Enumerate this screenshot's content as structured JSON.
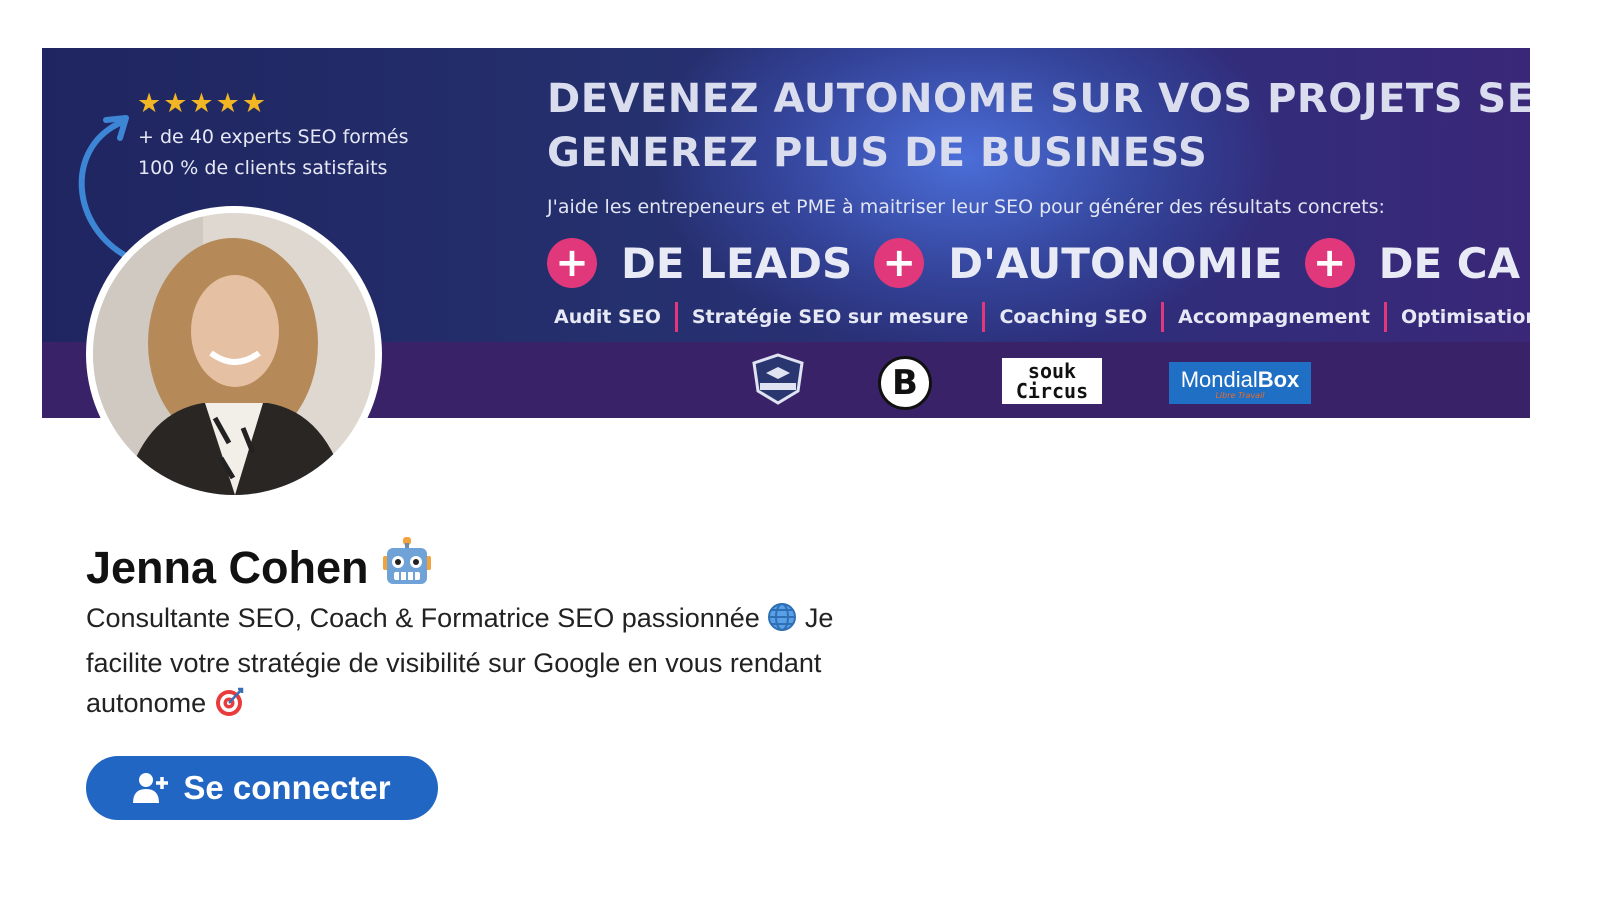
{
  "banner": {
    "stars": "★★★★★",
    "stat_line_1": "+ de 40 experts SEO formés",
    "stat_line_2": "100 % de clients satisfaits",
    "headline_line_1": "DEVENEZ AUTONOME SUR VOS PROJETS SEO,",
    "headline_line_2": "GENEREZ PLUS DE BUSINESS",
    "subline": "J'aide les entrepeneurs et PME à maitriser leur SEO pour générer des résultats concrets:",
    "plus_symbol": "+",
    "benefits": [
      "DE LEADS",
      "D'AUTONOMIE",
      "DE CA"
    ],
    "services": [
      "Audit SEO",
      "Stratégie SEO sur mesure",
      "Coaching SEO",
      "Accompagnement",
      "Optimisation"
    ],
    "logos": {
      "academy": "SIX ACADEMY",
      "b": "B",
      "souk_line_1": "souk",
      "souk_line_2": "Circus",
      "mondial_main_1": "Mondial",
      "mondial_main_2": "Box",
      "mondial_tag": "Libre Travail"
    },
    "colors": {
      "accent_pink": "#e0387a",
      "banner_navy": "#25306e",
      "banner_purple": "#3a2268"
    }
  },
  "profile": {
    "name": "Jenna Cohen",
    "name_emoji": "robot-icon",
    "headline_part_1": "Consultante SEO, Coach & Formatrice SEO passionnée",
    "headline_part_2": "Je facilite votre stratégie de visibilité sur Google en vous rendant autonome",
    "headline_emoji_1": "globe-icon",
    "headline_emoji_2": "target-icon"
  },
  "actions": {
    "connect_label": "Se connecter",
    "connect_icon": "add-person-icon",
    "connect_color": "#2266c4"
  }
}
